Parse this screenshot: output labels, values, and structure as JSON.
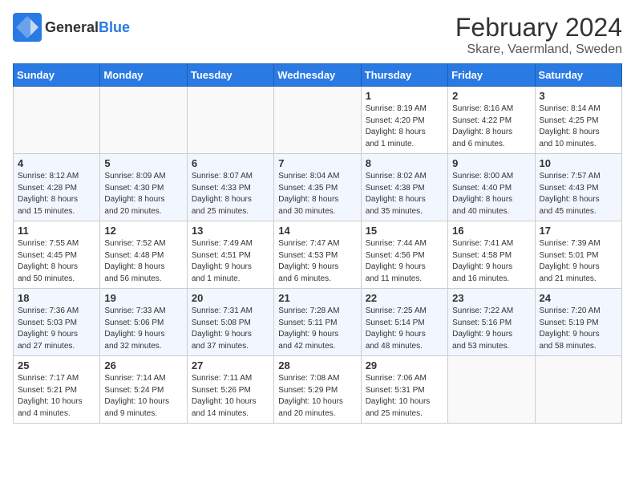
{
  "header": {
    "logo": {
      "general": "General",
      "blue": "Blue"
    },
    "title": "February 2024",
    "subtitle": "Skare, Vaermland, Sweden"
  },
  "weekdays": [
    "Sunday",
    "Monday",
    "Tuesday",
    "Wednesday",
    "Thursday",
    "Friday",
    "Saturday"
  ],
  "weeks": [
    [
      {
        "day": "",
        "info": ""
      },
      {
        "day": "",
        "info": ""
      },
      {
        "day": "",
        "info": ""
      },
      {
        "day": "",
        "info": ""
      },
      {
        "day": "1",
        "info": "Sunrise: 8:19 AM\nSunset: 4:20 PM\nDaylight: 8 hours\nand 1 minute."
      },
      {
        "day": "2",
        "info": "Sunrise: 8:16 AM\nSunset: 4:22 PM\nDaylight: 8 hours\nand 6 minutes."
      },
      {
        "day": "3",
        "info": "Sunrise: 8:14 AM\nSunset: 4:25 PM\nDaylight: 8 hours\nand 10 minutes."
      }
    ],
    [
      {
        "day": "4",
        "info": "Sunrise: 8:12 AM\nSunset: 4:28 PM\nDaylight: 8 hours\nand 15 minutes."
      },
      {
        "day": "5",
        "info": "Sunrise: 8:09 AM\nSunset: 4:30 PM\nDaylight: 8 hours\nand 20 minutes."
      },
      {
        "day": "6",
        "info": "Sunrise: 8:07 AM\nSunset: 4:33 PM\nDaylight: 8 hours\nand 25 minutes."
      },
      {
        "day": "7",
        "info": "Sunrise: 8:04 AM\nSunset: 4:35 PM\nDaylight: 8 hours\nand 30 minutes."
      },
      {
        "day": "8",
        "info": "Sunrise: 8:02 AM\nSunset: 4:38 PM\nDaylight: 8 hours\nand 35 minutes."
      },
      {
        "day": "9",
        "info": "Sunrise: 8:00 AM\nSunset: 4:40 PM\nDaylight: 8 hours\nand 40 minutes."
      },
      {
        "day": "10",
        "info": "Sunrise: 7:57 AM\nSunset: 4:43 PM\nDaylight: 8 hours\nand 45 minutes."
      }
    ],
    [
      {
        "day": "11",
        "info": "Sunrise: 7:55 AM\nSunset: 4:45 PM\nDaylight: 8 hours\nand 50 minutes."
      },
      {
        "day": "12",
        "info": "Sunrise: 7:52 AM\nSunset: 4:48 PM\nDaylight: 8 hours\nand 56 minutes."
      },
      {
        "day": "13",
        "info": "Sunrise: 7:49 AM\nSunset: 4:51 PM\nDaylight: 9 hours\nand 1 minute."
      },
      {
        "day": "14",
        "info": "Sunrise: 7:47 AM\nSunset: 4:53 PM\nDaylight: 9 hours\nand 6 minutes."
      },
      {
        "day": "15",
        "info": "Sunrise: 7:44 AM\nSunset: 4:56 PM\nDaylight: 9 hours\nand 11 minutes."
      },
      {
        "day": "16",
        "info": "Sunrise: 7:41 AM\nSunset: 4:58 PM\nDaylight: 9 hours\nand 16 minutes."
      },
      {
        "day": "17",
        "info": "Sunrise: 7:39 AM\nSunset: 5:01 PM\nDaylight: 9 hours\nand 21 minutes."
      }
    ],
    [
      {
        "day": "18",
        "info": "Sunrise: 7:36 AM\nSunset: 5:03 PM\nDaylight: 9 hours\nand 27 minutes."
      },
      {
        "day": "19",
        "info": "Sunrise: 7:33 AM\nSunset: 5:06 PM\nDaylight: 9 hours\nand 32 minutes."
      },
      {
        "day": "20",
        "info": "Sunrise: 7:31 AM\nSunset: 5:08 PM\nDaylight: 9 hours\nand 37 minutes."
      },
      {
        "day": "21",
        "info": "Sunrise: 7:28 AM\nSunset: 5:11 PM\nDaylight: 9 hours\nand 42 minutes."
      },
      {
        "day": "22",
        "info": "Sunrise: 7:25 AM\nSunset: 5:14 PM\nDaylight: 9 hours\nand 48 minutes."
      },
      {
        "day": "23",
        "info": "Sunrise: 7:22 AM\nSunset: 5:16 PM\nDaylight: 9 hours\nand 53 minutes."
      },
      {
        "day": "24",
        "info": "Sunrise: 7:20 AM\nSunset: 5:19 PM\nDaylight: 9 hours\nand 58 minutes."
      }
    ],
    [
      {
        "day": "25",
        "info": "Sunrise: 7:17 AM\nSunset: 5:21 PM\nDaylight: 10 hours\nand 4 minutes."
      },
      {
        "day": "26",
        "info": "Sunrise: 7:14 AM\nSunset: 5:24 PM\nDaylight: 10 hours\nand 9 minutes."
      },
      {
        "day": "27",
        "info": "Sunrise: 7:11 AM\nSunset: 5:26 PM\nDaylight: 10 hours\nand 14 minutes."
      },
      {
        "day": "28",
        "info": "Sunrise: 7:08 AM\nSunset: 5:29 PM\nDaylight: 10 hours\nand 20 minutes."
      },
      {
        "day": "29",
        "info": "Sunrise: 7:06 AM\nSunset: 5:31 PM\nDaylight: 10 hours\nand 25 minutes."
      },
      {
        "day": "",
        "info": ""
      },
      {
        "day": "",
        "info": ""
      }
    ]
  ]
}
